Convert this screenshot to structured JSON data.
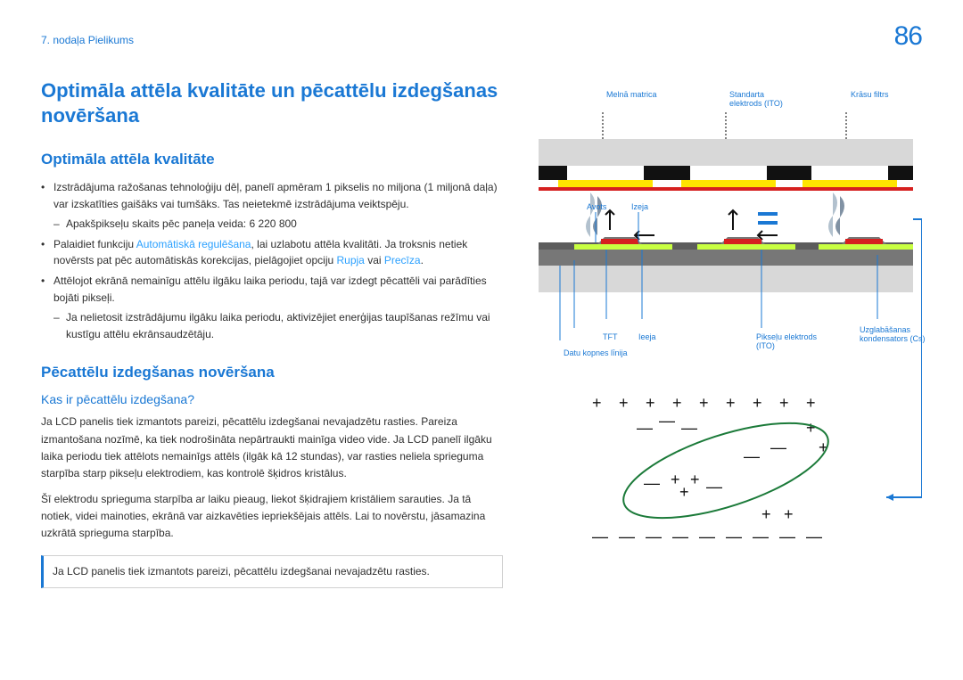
{
  "header": {
    "chapter": "7. nodaļa Pielikums",
    "page": "86"
  },
  "h1": "Optimāla attēla kvalitāte un pēcattēlu izdegšanas novēršana",
  "h2a": "Optimāla attēla kvalitāte",
  "b1": "Izstrādājuma ražošanas tehnoloģiju dēļ, panelī apmēram 1 pikselis no miljona (1 miljonā daļa) var izskatīties gaišāks vai tumšāks. Tas neietekmē izstrādājuma veiktspēju.",
  "b1d": "Apakšpikseļu skaits pēc paneļa veida: 6 220 800",
  "b2_pre": "Palaidiet funkciju ",
  "b2_auto": "Automātiskā regulēšana",
  "b2_mid": ", lai uzlabotu attēla kvalitāti. Ja troksnis netiek novērsts pat pēc automātiskās korekcijas, pielāgojiet opciju ",
  "b2_r": "Rupja",
  "b2_or": " vai ",
  "b2_p": "Precīza",
  "b2_end": ".",
  "b3": "Attēlojot ekrānā nemainīgu attēlu ilgāku laika periodu, tajā var izdegt pēcattēli vai parādīties bojāti pikseļi.",
  "b3d": "Ja nelietosit izstrādājumu ilgāku laika periodu, aktivizējiet enerģijas taupīšanas režīmu vai kustīgu attēlu ekrānsaudzētāju.",
  "h2b": "Pēcattēlu izdegšanas novēršana",
  "h3": "Kas ir pēcattēlu izdegšana?",
  "p1": "Ja LCD panelis tiek izmantots pareizi, pēcattēlu izdegšanai nevajadzētu rasties. Pareiza izmantošana nozīmē, ka tiek nodrošināta nepārtraukti mainīga video vide. Ja LCD panelī ilgāku laika periodu tiek attēlots nemainīgs attēls (ilgāk kā 12 stundas), var rasties neliela sprieguma starpība starp pikseļu elektrodiem, kas kontrolē šķidros kristālus.",
  "p2": "Šī elektrodu sprieguma starpība ar laiku pieaug, liekot šķidrajiem kristāliem sarauties. Ja tā notiek, videi mainoties, ekrānā var aizkavēties iepriekšējais attēls. Lai to novērstu, jāsamazina uzkrātā sprieguma starpība.",
  "note": "Ja LCD panelis tiek izmantots pareizi, pēcattēlu izdegšanai nevajadzētu rasties.",
  "diag": {
    "melna": "Melnā matrica",
    "standarta": "Standarta elektrods (ITO)",
    "krasu": "Krāsu filtrs",
    "avots": "Avots",
    "izeja": "Izeja",
    "tft": "TFT",
    "ieeja": "Ieeja",
    "datu": "Datu kopnes līnija",
    "pikselu": "Pikseļu elektrods (ITO)",
    "uzglab": "Uzglabāšanas kondensators (Cs)"
  }
}
